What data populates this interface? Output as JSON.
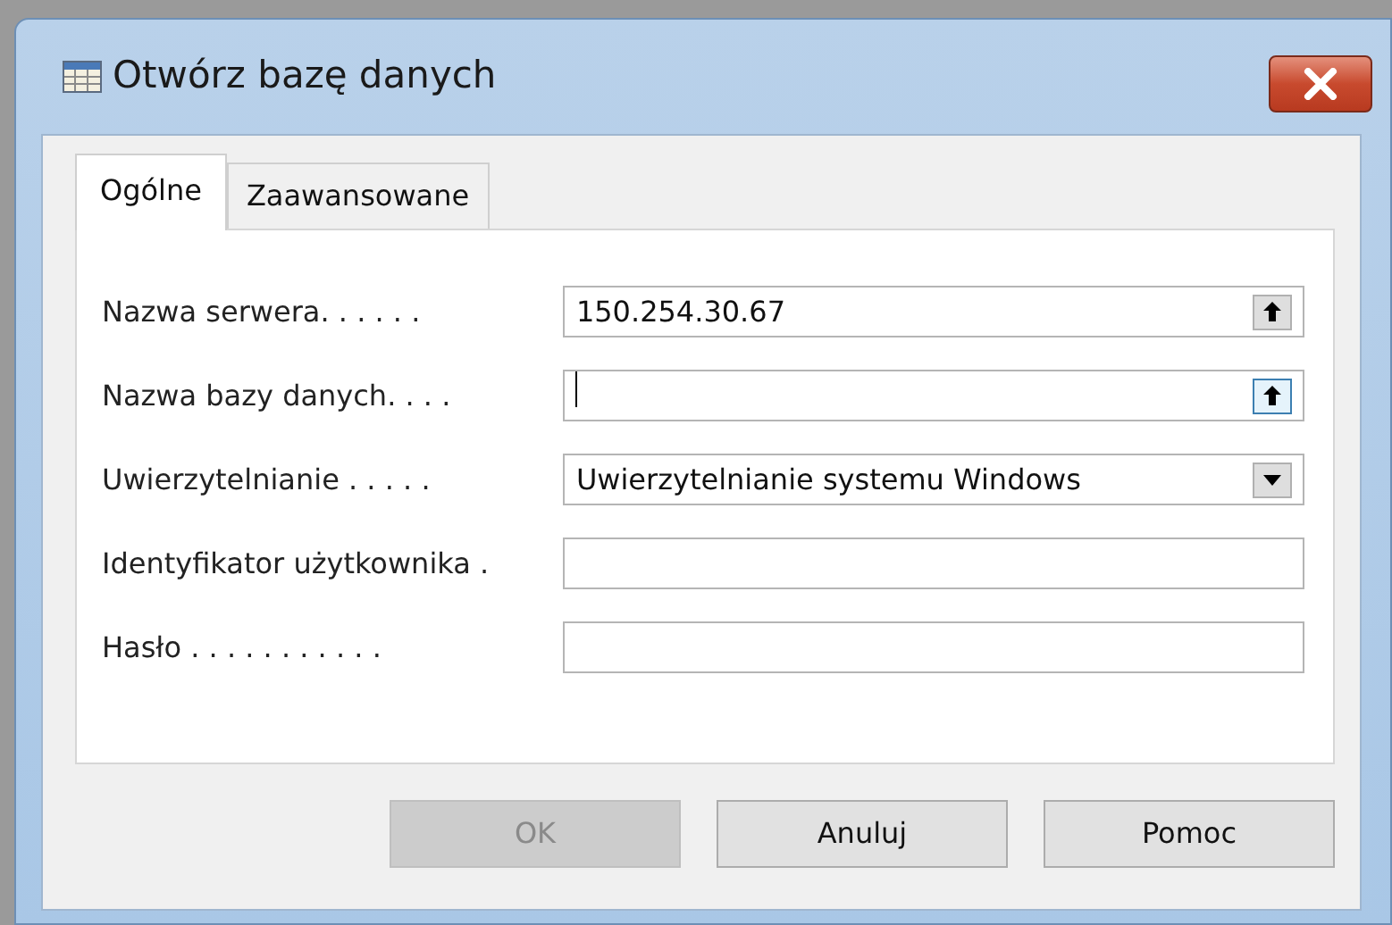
{
  "window": {
    "title": "Otwórz bazę danych"
  },
  "tabs": [
    {
      "label": "Ogólne",
      "selected": true
    },
    {
      "label": "Zaawansowane",
      "selected": false
    }
  ],
  "fields": [
    {
      "label": "Nazwa serwera. . . . . .",
      "kind": "lookup",
      "value": "150.254.30.67",
      "focused": false
    },
    {
      "label": "Nazwa bazy danych. . . .",
      "kind": "lookup",
      "focused": true
    },
    {
      "label": "Uwierzytelnianie . . . . .",
      "kind": "dropdown",
      "value": "Uwierzytelnianie systemu Windows",
      "focused": false
    },
    {
      "label": "Identyfikator użytkownika .",
      "kind": "text",
      "focused": false
    },
    {
      "label": "Hasło . . . . . . . . . . .",
      "kind": "text",
      "focused": false
    }
  ],
  "buttons": [
    {
      "label": "OK",
      "disabled": true
    },
    {
      "label": "Anuluj",
      "disabled": false
    },
    {
      "label": "Pomoc",
      "disabled": false
    }
  ]
}
